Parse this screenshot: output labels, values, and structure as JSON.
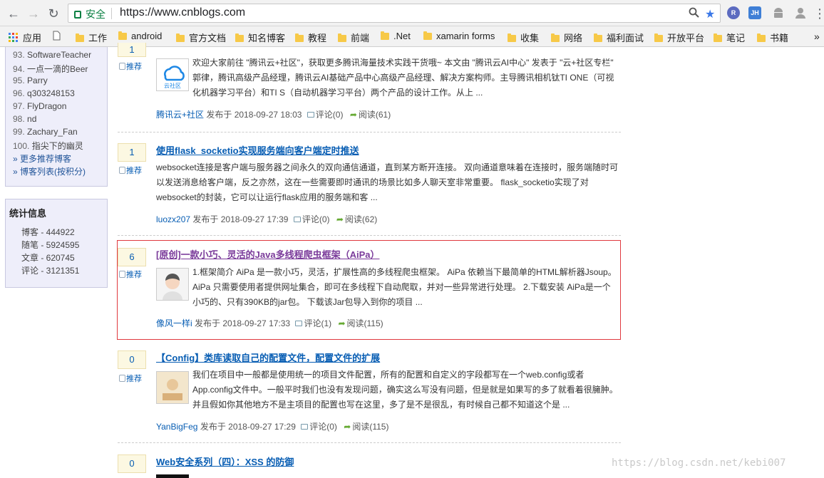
{
  "browser": {
    "back_glyph": "←",
    "forward_glyph": "→",
    "reload_glyph": "↻",
    "secure_label": "安全",
    "url": "https://www.cnblogs.com",
    "search_icon": "search-icon",
    "bookmark_star": "★",
    "extensions": [
      {
        "name": "extension-r",
        "text": "R",
        "color": "#5c6bc0"
      },
      {
        "name": "extension-jh",
        "text": "JH",
        "color": "#3f7fd6"
      },
      {
        "name": "extension-android",
        "text": "",
        "color": "#9e9e9e"
      },
      {
        "name": "extension-profile",
        "text": "",
        "color": "#9e9e9e"
      }
    ],
    "menu_glyph": "⋮",
    "bookmarks": [
      {
        "label": "应用",
        "type": "apps"
      },
      {
        "label": "",
        "type": "page"
      },
      {
        "label": "工作",
        "type": "folder"
      },
      {
        "label": "android",
        "type": "folder"
      },
      {
        "label": "官方文档",
        "type": "folder"
      },
      {
        "label": "知名博客",
        "type": "folder"
      },
      {
        "label": "教程",
        "type": "folder"
      },
      {
        "label": "前端",
        "type": "folder"
      },
      {
        "label": ".Net",
        "type": "folder"
      },
      {
        "label": "xamarin forms",
        "type": "folder"
      },
      {
        "label": "收集",
        "type": "folder"
      },
      {
        "label": "网络",
        "type": "folder"
      },
      {
        "label": "福利面试",
        "type": "folder"
      },
      {
        "label": "开放平台",
        "type": "folder"
      },
      {
        "label": "笔记",
        "type": "folder"
      },
      {
        "label": "书籍",
        "type": "folder"
      }
    ],
    "bookmarks_overflow": "»"
  },
  "sidebar": {
    "top_bloggers": [
      {
        "num": "93.",
        "name": "SoftwareTeacher"
      },
      {
        "num": "94.",
        "name": "一点一滴的Beer"
      },
      {
        "num": "95.",
        "name": "Parry"
      },
      {
        "num": "96.",
        "name": "q303248153"
      },
      {
        "num": "97.",
        "name": "FlyDragon"
      },
      {
        "num": "98.",
        "name": "nd"
      },
      {
        "num": "99.",
        "name": "Zachary_Fan"
      },
      {
        "num": "100.",
        "name": "指尖下的幽灵"
      }
    ],
    "more_recommended": "» 更多推荐博客",
    "blogger_list": "» 博客列表(按积分)",
    "stats_title": "统计信息",
    "stats": [
      "博客 - 444922",
      "随笔 - 5924595",
      "文章 - 620745",
      "评论 - 3121351"
    ]
  },
  "posts": [
    {
      "digg": "1",
      "recommend": "推荐",
      "title": "",
      "avatar_label": "云社区",
      "summary": "欢迎大家前往 \"腾讯云+社区\"，获取更多腾讯海量技术实践干货哦~ 本文由 \"腾讯云AI中心\" 发表于 \"云+社区专栏\" 郭律，腾讯高级产品经理，腾讯云AI基础产品中心高级产品经理、解决方案构师。主导腾讯相机钛TI ONE（可视化机器学习平台）和TI S（自动机器学习平台）两个产品的设计工作。从上 ...",
      "author": "腾讯云+社区",
      "posted": "发布于 2018-09-27 18:03",
      "comments": "评论(0)",
      "reads": "阅读(61)"
    },
    {
      "digg": "1",
      "recommend": "推荐",
      "title": "使用flask_socketio实现服务端向客户端定时推送",
      "summary": "websocket连接是客户端与服务器之间永久的双向通信通道，直到某方断开连接。 双向通道意味着在连接时，服务端随时可以发送消息给客户端，反之亦然，这在一些需要即时通讯的场景比如多人聊天室非常重要。 flask_socketio实现了对websocket的封装，它可以让运行flask应用的服务端和客 ...",
      "author": "luozx207",
      "posted": "发布于 2018-09-27 17:39",
      "comments": "评论(0)",
      "reads": "阅读(62)"
    },
    {
      "digg": "6",
      "recommend": "推荐",
      "title": "[原创]一款小巧、灵活的Java多线程爬虫框架（AiPa）",
      "summary": "1.框架简介 AiPa 是一款小巧，灵活，扩展性高的多线程爬虫框架。 AiPa 依赖当下最简单的HTML解析器Jsoup。 AiPa 只需要使用者提供网址集合，即可在多线程下自动爬取，并对一些异常进行处理。 2.下载安装 AiPa是一个小巧的、只有390KB的jar包。 下载该Jar包导入到你的项目 ...",
      "author": "像风一样i",
      "posted": "发布于 2018-09-27 17:33",
      "comments": "评论(1)",
      "reads": "阅读(115)"
    },
    {
      "digg": "0",
      "recommend": "推荐",
      "title": "【Config】类库读取自己的配置文件，配置文件的扩展",
      "summary": "我们在项目中一般都是使用统一的项目文件配置，所有的配置和自定义的字段都写在一个web.config或者App.config文件中。一般平时我们也没有发现问题，确实这么写没有问题，但是就是如果写的多了就看着很臃肿。并且假如你其他地方不是主项目的配置也写在这里，多了是不是很乱，有时候自己都不知道这个是 ...",
      "author": "YanBigFeg",
      "posted": "发布于 2018-09-27 17:29",
      "comments": "评论(0)",
      "reads": "阅读(115)"
    },
    {
      "digg": "0",
      "title": "Web安全系列（四）：XSS 的防御"
    }
  ],
  "watermark": "https://blog.csdn.net/kebi007"
}
